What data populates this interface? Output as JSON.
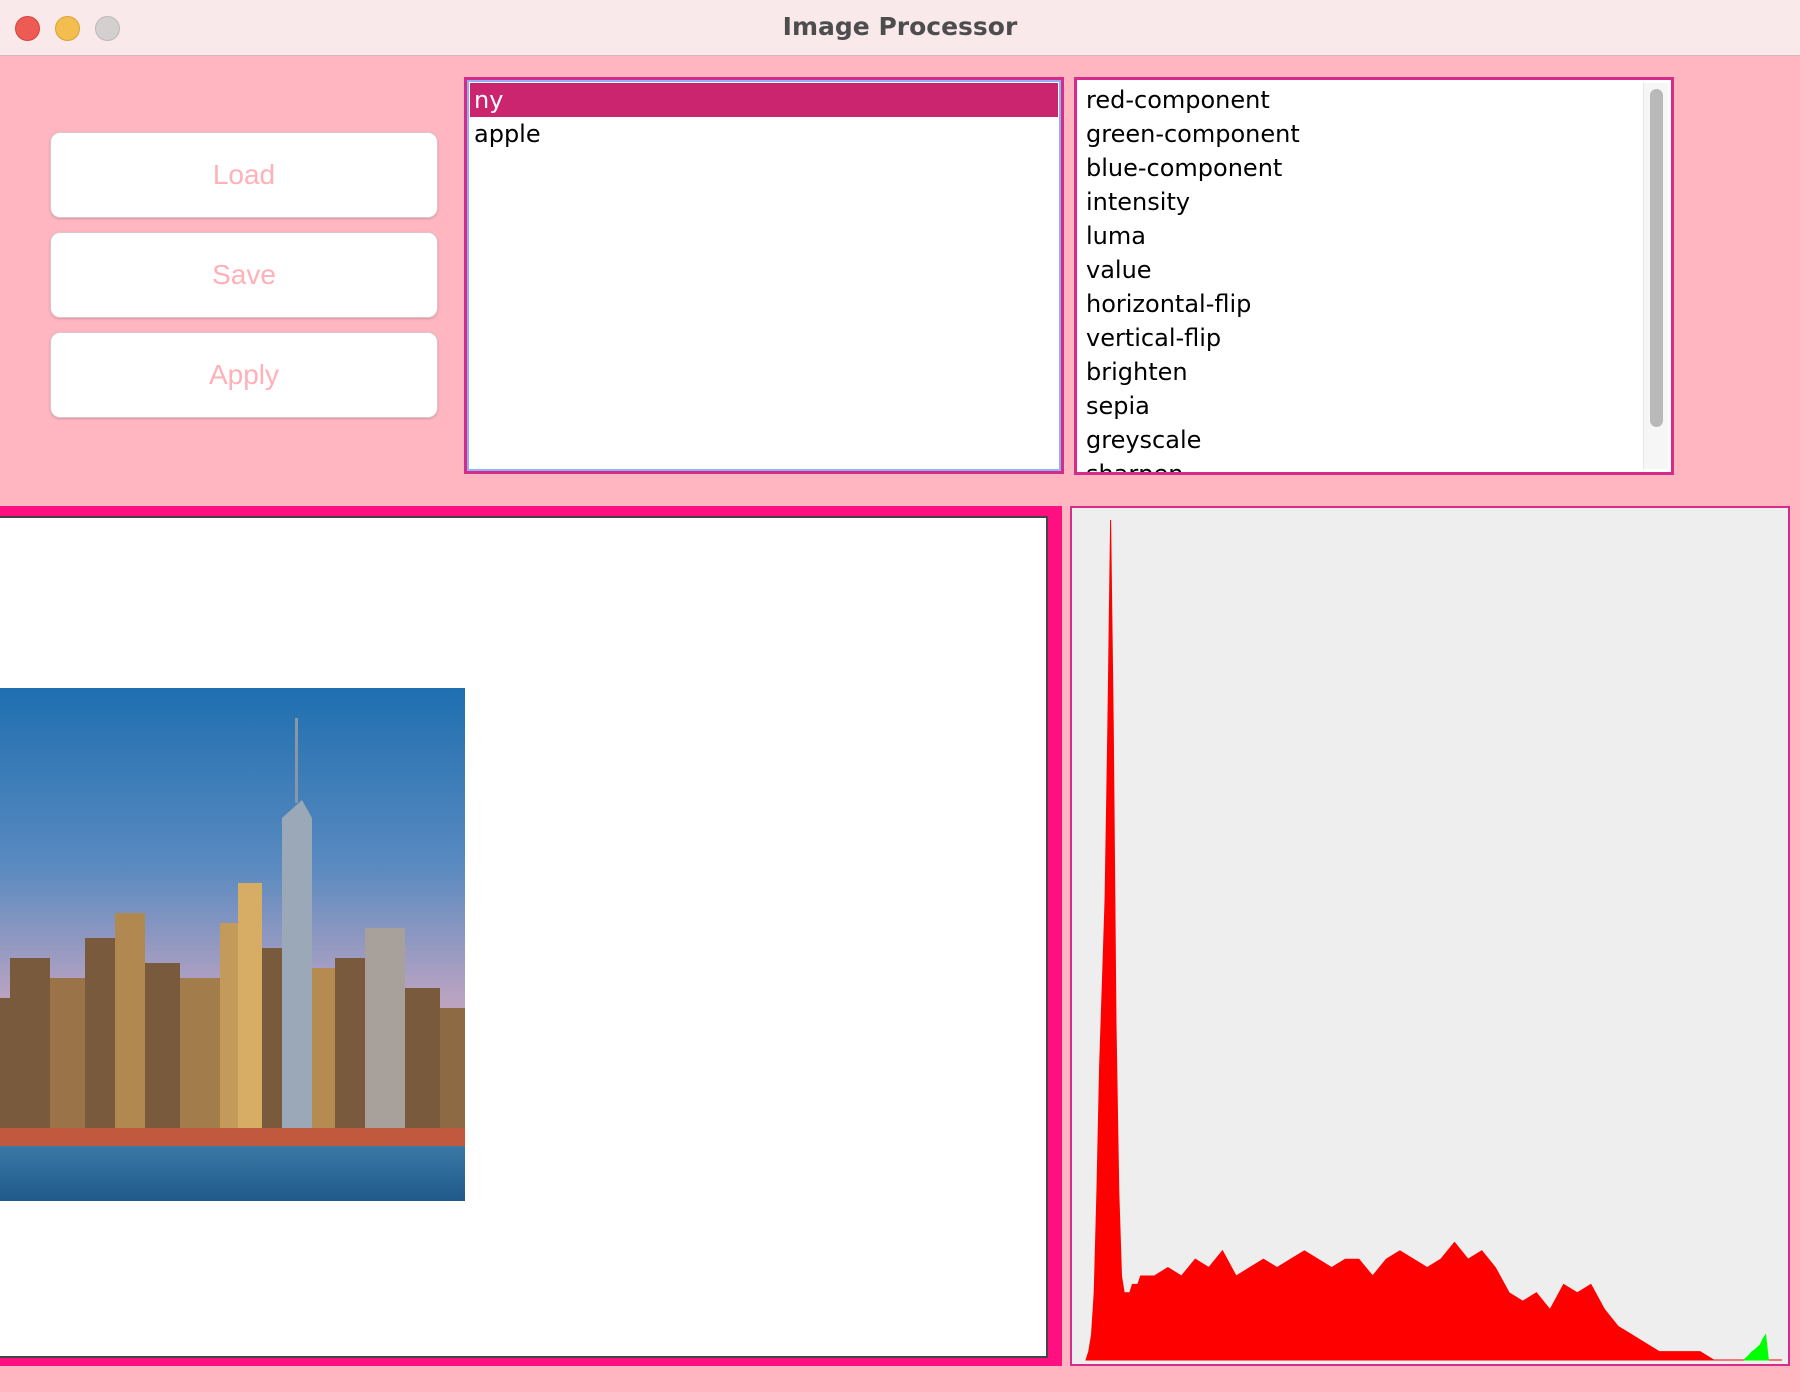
{
  "window": {
    "title": "Image Processor"
  },
  "buttons": {
    "load": "Load",
    "save": "Save",
    "apply": "Apply"
  },
  "images": {
    "items": [
      "ny",
      "apple"
    ],
    "selected": "ny"
  },
  "operations": {
    "items": [
      "red-component",
      "green-component",
      "blue-component",
      "intensity",
      "luma",
      "value",
      "horizontal-flip",
      "vertical-flip",
      "brighten",
      "sepia",
      "greyscale",
      "sharpen"
    ]
  },
  "colors": {
    "background": "#ffb6c1",
    "accent": "#ff0f7f",
    "selection": "#cc2570",
    "button_text": "#ffb0b8",
    "histogram_red": "#ff0000",
    "histogram_green": "#00ff00"
  },
  "chart_data": {
    "type": "area",
    "title": "",
    "xlabel": "",
    "ylabel": "",
    "xlim": [
      0,
      255
    ],
    "ylim": [
      0,
      100
    ],
    "grid": false,
    "series": [
      {
        "color": "#ff0000",
        "x": [
          0,
          1,
          2,
          3,
          4,
          5,
          6,
          7,
          8,
          9,
          10,
          11,
          12,
          13,
          14,
          15,
          16,
          17,
          18,
          19,
          20,
          25,
          30,
          35,
          40,
          45,
          50,
          55,
          60,
          65,
          70,
          75,
          80,
          85,
          90,
          95,
          100,
          105,
          110,
          115,
          120,
          125,
          130,
          135,
          140,
          145,
          150,
          155,
          160,
          165,
          170,
          175,
          180,
          185,
          190,
          195,
          200,
          205,
          210,
          215,
          220,
          225,
          230,
          235,
          240,
          255
        ],
        "values": [
          0,
          1,
          3,
          8,
          20,
          35,
          45,
          55,
          75,
          100,
          75,
          40,
          20,
          10,
          8,
          8,
          8,
          9,
          9,
          9,
          10,
          10,
          11,
          10,
          12,
          11,
          13,
          10,
          11,
          12,
          11,
          12,
          13,
          12,
          11,
          12,
          12,
          10,
          12,
          13,
          12,
          11,
          12,
          14,
          12,
          13,
          11,
          8,
          7,
          8,
          6,
          9,
          8,
          9,
          6,
          4,
          3,
          2,
          1,
          1,
          1,
          1,
          0,
          0,
          0,
          0
        ]
      },
      {
        "color": "#00ff00",
        "x": [
          241,
          242,
          243,
          244,
          245,
          246,
          247,
          248,
          249,
          250
        ],
        "values": [
          0,
          0.3,
          0.6,
          1,
          1.2,
          1.5,
          1.8,
          2.5,
          3,
          0
        ]
      }
    ]
  }
}
